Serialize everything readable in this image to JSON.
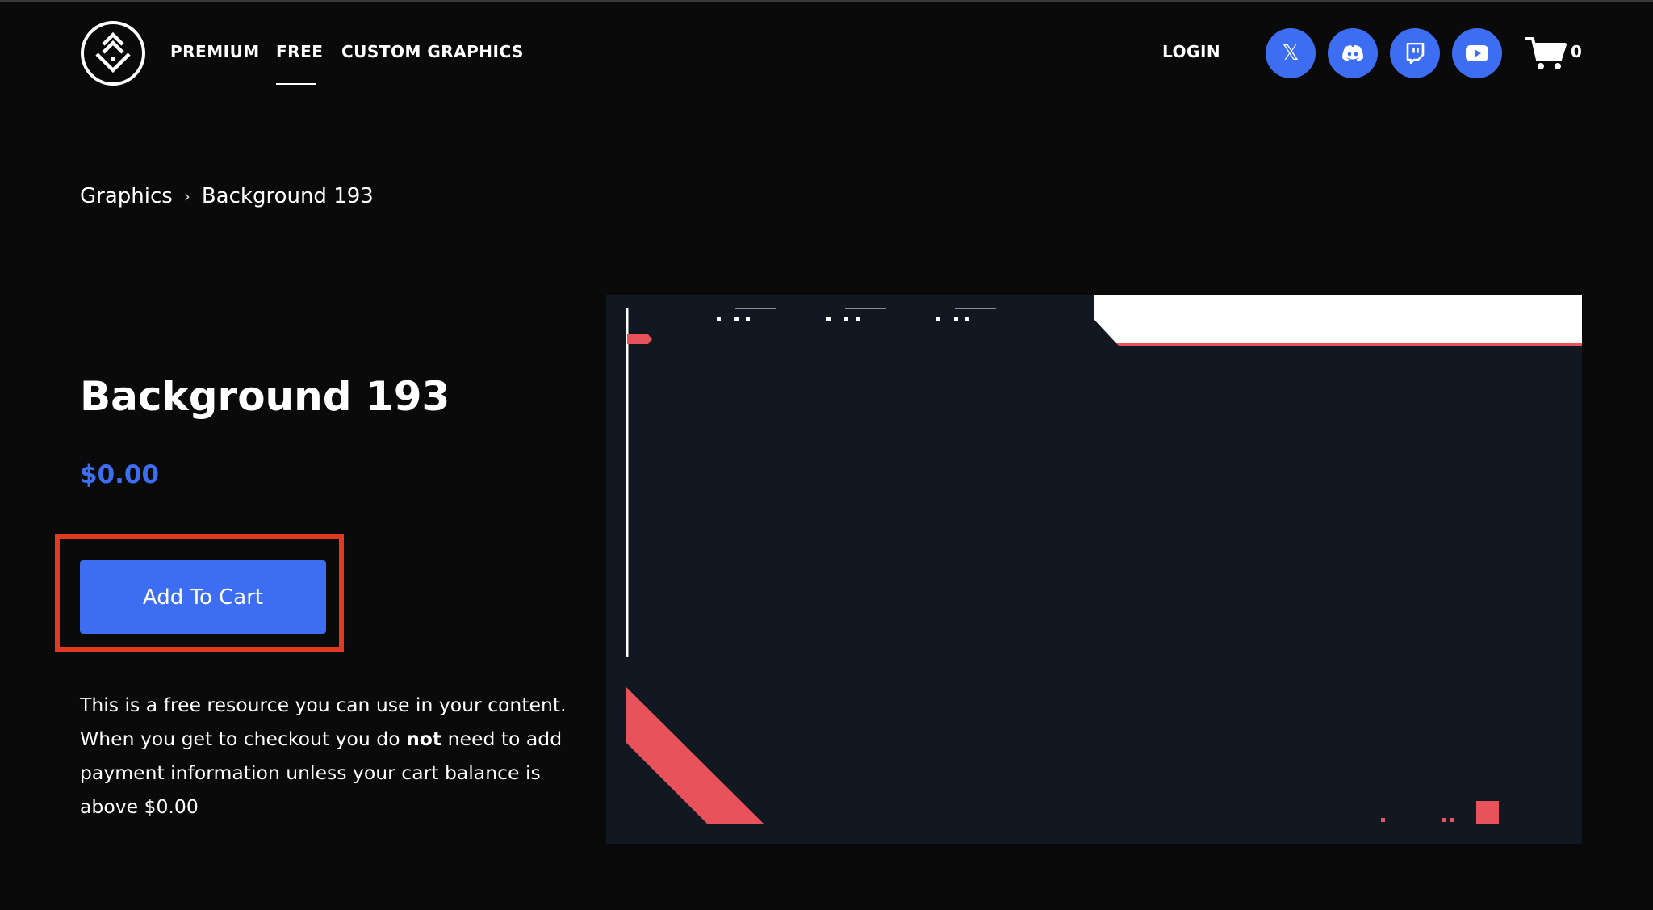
{
  "header": {
    "logo_icon": "chevrons-diamond-logo-icon",
    "nav": [
      {
        "label": "PREMIUM",
        "active": false
      },
      {
        "label": "FREE",
        "active": true
      },
      {
        "label": "CUSTOM GRAPHICS",
        "active": false
      }
    ],
    "login_label": "LOGIN",
    "social": [
      {
        "icon": "x-icon",
        "glyph": "𝕏"
      },
      {
        "icon": "discord-icon"
      },
      {
        "icon": "twitch-icon"
      },
      {
        "icon": "youtube-icon"
      }
    ],
    "cart_icon": "cart-icon",
    "cart_count": "0"
  },
  "breadcrumb": {
    "parent": "Graphics",
    "separator": "›",
    "current": "Background 193"
  },
  "product": {
    "title": "Background 193",
    "price": "$0.00",
    "add_to_cart_label": "Add To Cart",
    "description": {
      "part1": "This is a free resource you can use in your content. When you get to checkout you do ",
      "bold": "not",
      "part2": " need to add payment information unless your cart balance is above $0.00"
    }
  },
  "colors": {
    "accent": "#3d6ef2",
    "highlight": "#e03a22",
    "preview_bg": "#111821",
    "preview_red": "#e8525a"
  }
}
